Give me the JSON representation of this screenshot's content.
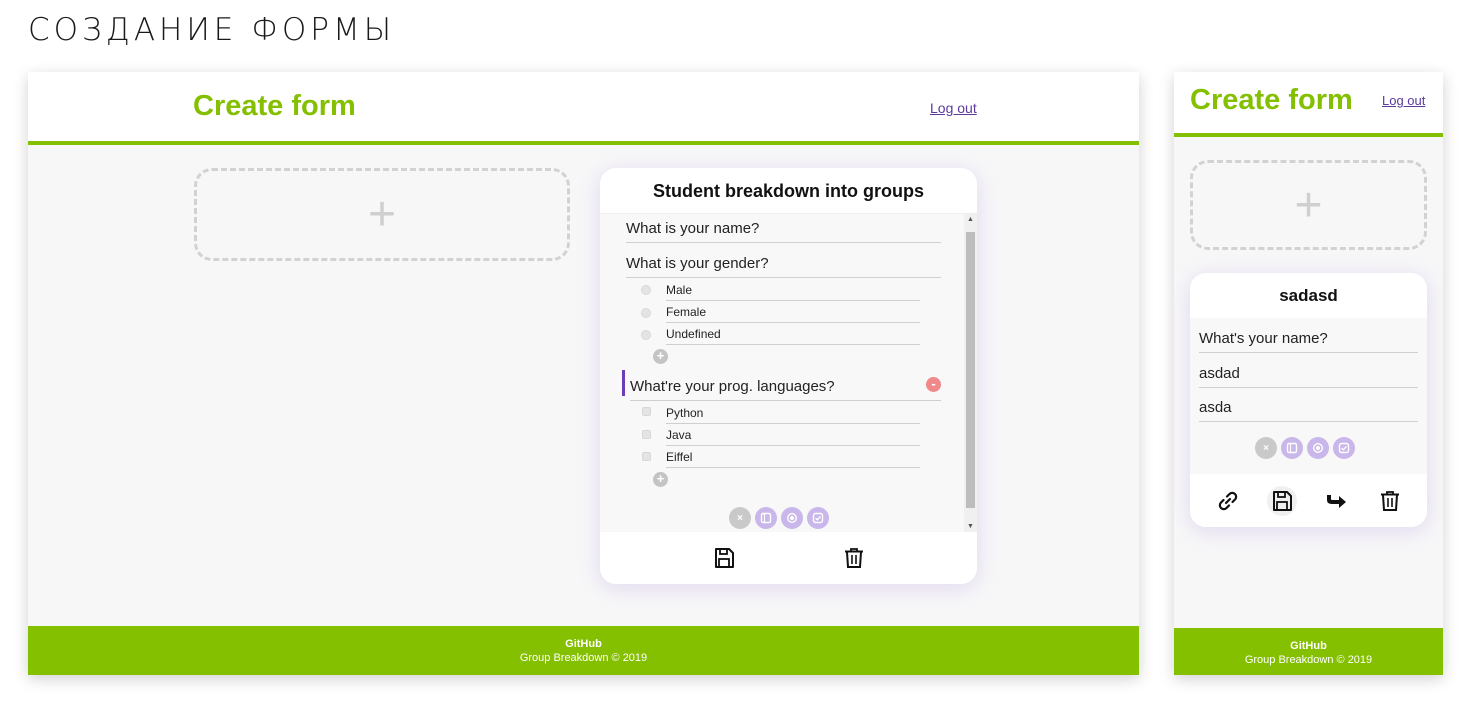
{
  "headline": "СОЗДАНИЕ ФОРМЫ",
  "desktop": {
    "app_title": "Create form",
    "logout_label": "Log out",
    "add_symbol": "+",
    "card": {
      "title": "Student breakdown into groups",
      "questions": [
        {
          "text": "What is your name?"
        },
        {
          "text": "What is your gender?",
          "options": [
            "Male",
            "Female",
            "Undefined"
          ]
        },
        {
          "text": "What're your prog. languages?",
          "options": [
            "Python",
            "Java",
            "Eiffel"
          ]
        }
      ],
      "add_option_symbol": "+",
      "remove_symbol": "-",
      "clear_symbol": "×"
    },
    "footer": {
      "github": "GitHub",
      "copyright": "Group Breakdown © 2019"
    }
  },
  "mobile": {
    "app_title": "Create form",
    "logout_label": "Log out",
    "add_symbol": "+",
    "card": {
      "title": "sadasd",
      "questions": [
        "What's your name?",
        "asdad",
        "asda"
      ],
      "clear_symbol": "×"
    },
    "footer": {
      "github": "GitHub",
      "copyright": "Group Breakdown © 2019"
    }
  },
  "icons": {
    "type_buttons": [
      "clear-icon",
      "text-type-icon",
      "radio-type-icon",
      "checkbox-type-icon"
    ],
    "card_actions_desktop": [
      "save-icon",
      "trash-icon"
    ],
    "card_actions_mobile": [
      "link-icon",
      "save-icon",
      "share-icon",
      "trash-icon"
    ]
  },
  "colors": {
    "brand_green": "#84bf00",
    "accent_purple": "#6a3fb5",
    "light_purple": "#c9b6ea",
    "remove_red": "#f08a8a"
  }
}
